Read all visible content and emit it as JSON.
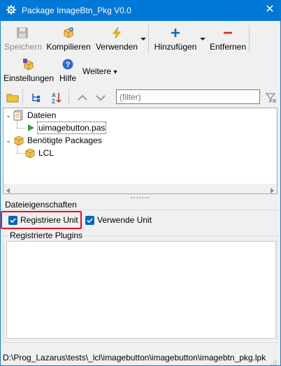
{
  "window": {
    "title": "Package ImageBtn_Pkg V0.0",
    "close_glyph": "✕"
  },
  "toolbar": {
    "save_label": "Speichern",
    "compile_label": "Kompilieren",
    "use_label": "Verwenden",
    "add_label": "Hinzufügen",
    "remove_label": "Entfernen",
    "options_label": "Einstellungen",
    "help_label": "Hilfe",
    "more_label": "Weitere",
    "more_arrow": "▾"
  },
  "filter": {
    "placeholder": "(filter)"
  },
  "tree": {
    "files_label": "Dateien",
    "file_item": "uimagebutton.pas",
    "required_label": "Benötigte Packages",
    "required_item": "LCL",
    "collapse_glyph": "⌄"
  },
  "file_properties": {
    "title": "Dateieigenschaften",
    "register_unit_label": "Registriere Unit",
    "register_unit_checked": true,
    "use_unit_label": "Verwende Unit",
    "use_unit_checked": true,
    "plugins_title": "Registrierte Plugins"
  },
  "status_bar": {
    "path": "D:\\Prog_Lazarus\\tests\\_lcl\\imagebutton\\imagebutton\\imagebtn_pkg.lpk"
  },
  "colors": {
    "titlebar": "#0078d7",
    "checkbox": "#0067c0",
    "highlight": "#e81123",
    "add_plus": "#1565c0",
    "remove_minus": "#e02020"
  },
  "icons": {
    "app": "lazarus-gear-icon",
    "save": "floppy-disk-icon",
    "compile": "package-gear-icon",
    "use": "lightning-icon",
    "add": "plus-icon",
    "remove": "minus-icon",
    "options": "package-settings-icon",
    "help": "help-circle-icon",
    "open": "folder-icon",
    "tree_view": "tree-view-icon",
    "sort": "sort-az-icon",
    "up": "arrow-up-icon",
    "down": "arrow-down-icon",
    "clear_filter": "clear-filter-icon"
  }
}
